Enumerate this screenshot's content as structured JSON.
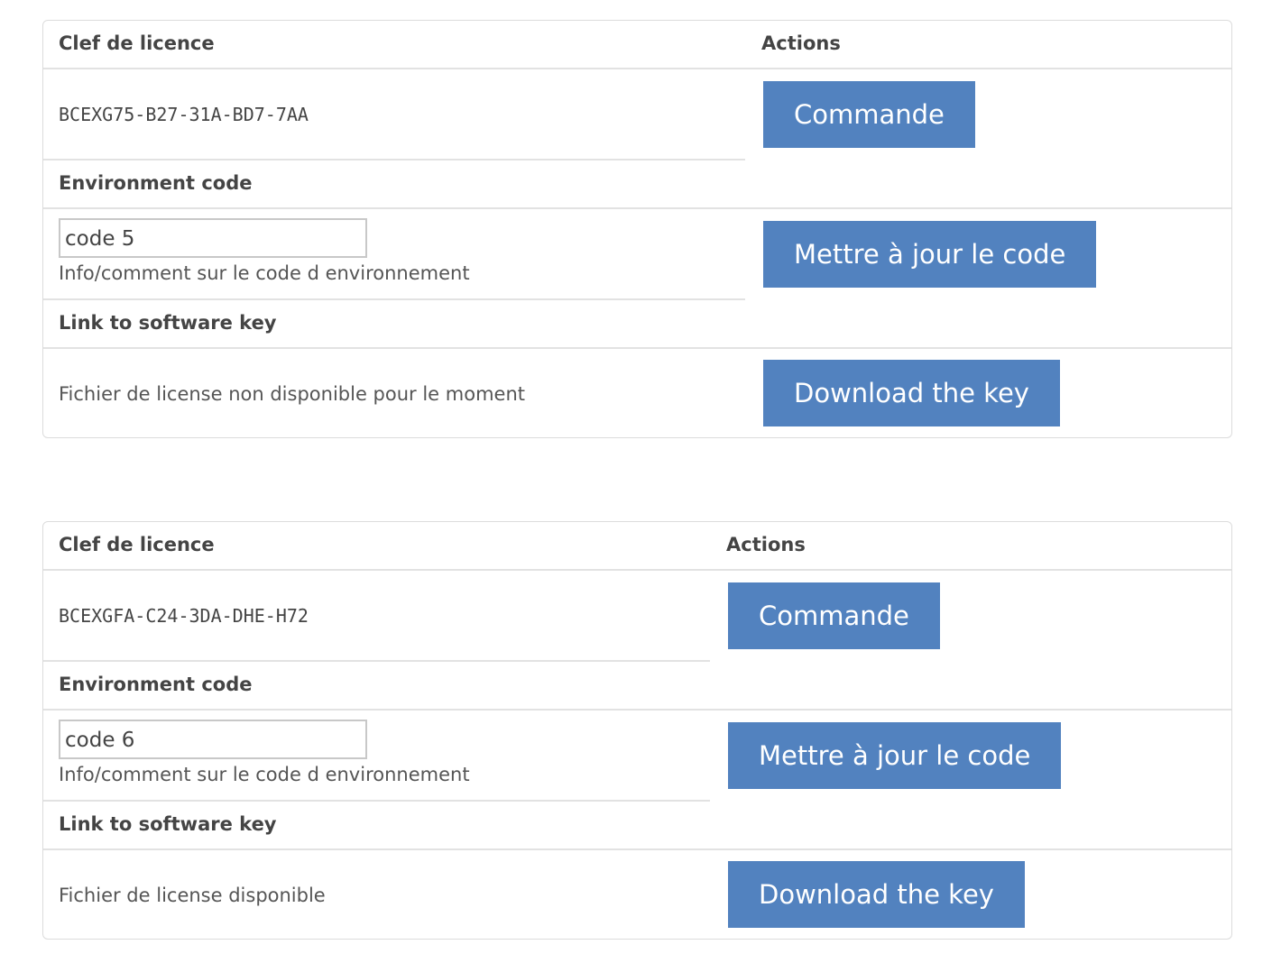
{
  "licenses": [
    {
      "header_key_label": "Clef de licence",
      "header_actions_label": "Actions",
      "license_key": "BCEXG75-B27-31A-BD7-7AA",
      "order_button": "Commande",
      "env_label": "Environment code",
      "env_value": "code 5",
      "env_info": "Info/comment sur le code d environnement",
      "update_button": "Mettre à jour le code",
      "link_label": "Link to software key",
      "file_status": "Fichier de license non disponible pour le moment",
      "download_button": "Download the key"
    },
    {
      "header_key_label": "Clef de licence",
      "header_actions_label": "Actions",
      "license_key": "BCEXGFA-C24-3DA-DHE-H72",
      "order_button": "Commande",
      "env_label": "Environment code",
      "env_value": "code 6",
      "env_info": "Info/comment sur le code d environnement",
      "update_button": "Mettre à jour le code",
      "link_label": "Link to software key",
      "file_status": "Fichier de license disponible",
      "download_button": "Download the key"
    }
  ],
  "colors": {
    "button_bg": "#5282bf",
    "button_text": "#ffffff",
    "border": "#dcdcdc",
    "text": "#444444"
  }
}
